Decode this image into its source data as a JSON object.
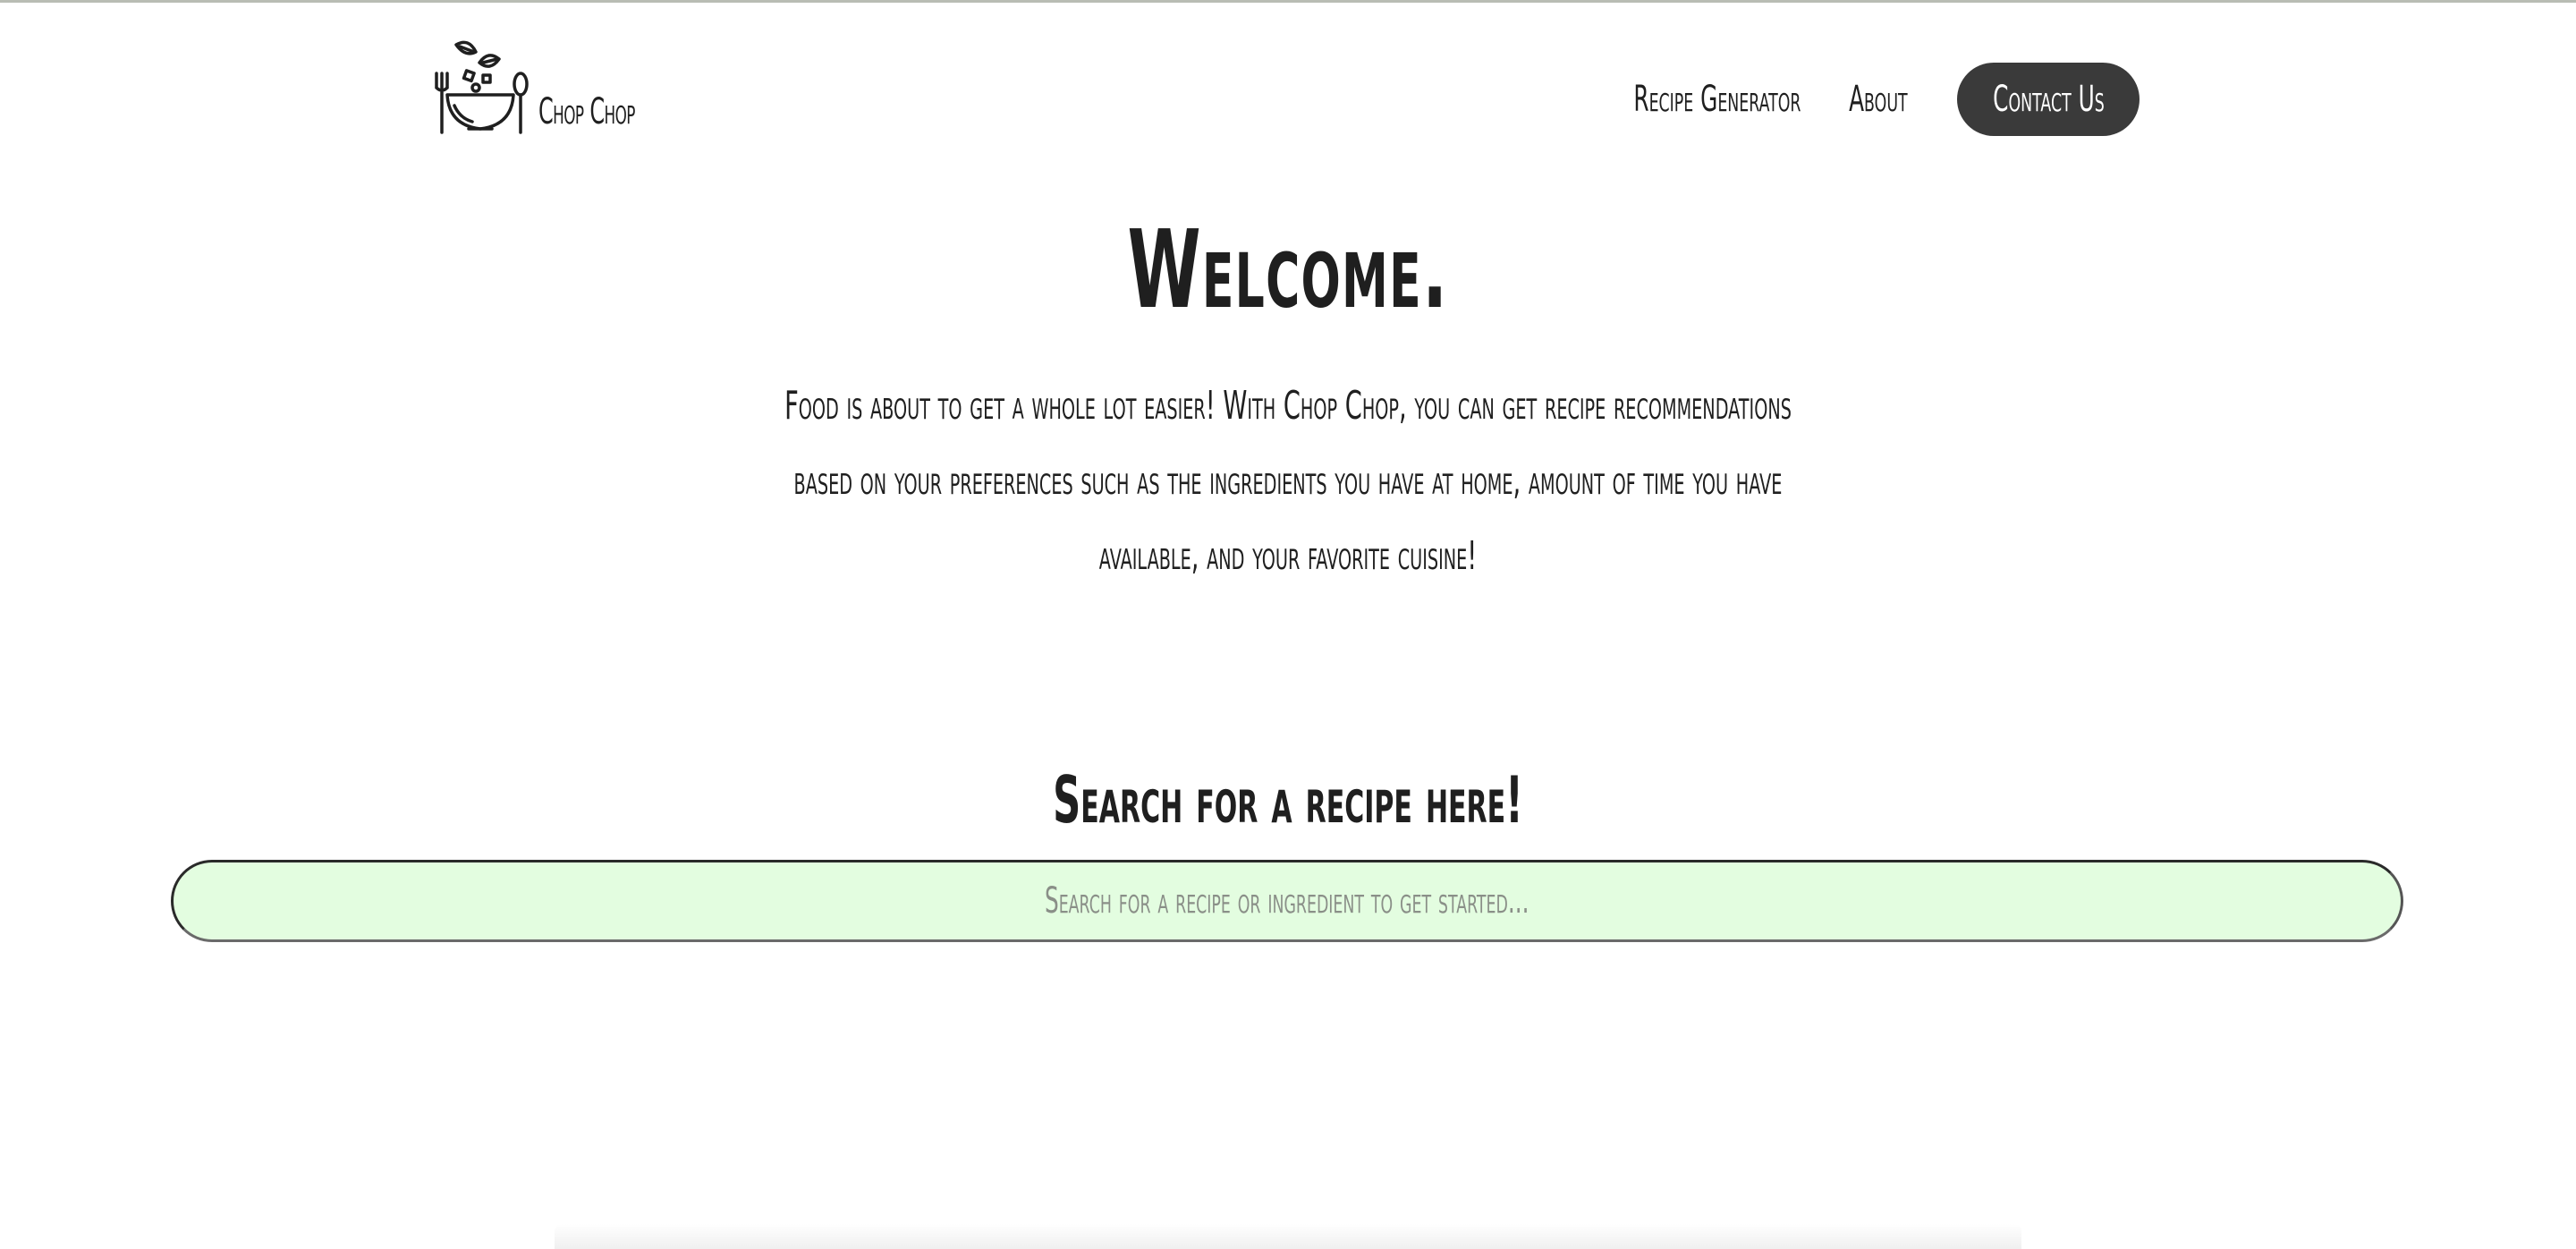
{
  "app": {
    "brand_name": "Chop Chop",
    "logo_icon": "salad-bowl-with-fork-and-spoon-icon"
  },
  "nav": {
    "items": [
      {
        "label": "Recipe Generator"
      },
      {
        "label": "About"
      }
    ],
    "contact_label": "Contact Us"
  },
  "hero": {
    "title": "Welcome.",
    "intro": "Food is about to get a whole lot easier! With Chop Chop, you can get recipe recommendations based on your preferences such as the ingredients you have at home, amount of time you have available, and your favorite cuisine!"
  },
  "search": {
    "heading": "Search for a recipe here!",
    "placeholder": "Search for a recipe or ingredient to get started...",
    "value": ""
  },
  "colors": {
    "contact_button_bg": "#3a3a3a",
    "search_bar_bg": "#e3fde0",
    "text": "#1f1f1f",
    "placeholder": "#8a8f88"
  }
}
